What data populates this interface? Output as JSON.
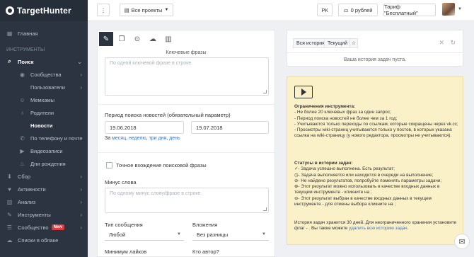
{
  "app": {
    "name": "TargetHunter"
  },
  "sidebar": {
    "main": "Главная",
    "section": "ИНСТРУМЕНТЫ",
    "search": "Поиск",
    "sub": [
      "Сообщества",
      "Пользователи",
      "Мемхамы",
      "Родители",
      "Новости",
      "По телефону и почте",
      "Видеозаписи",
      "Дни рождения"
    ],
    "groups": [
      "Сбор",
      "Активности",
      "Анализ",
      "Инструменты",
      "Сообщество",
      "Списки в облаке"
    ],
    "new_badge": "New"
  },
  "topbar": {
    "menu_icon": "⋮",
    "projects": "Все проекты",
    "region": "РК",
    "balance": "0 рублей",
    "tariff": "Тариф \"Бесплатный\""
  },
  "form": {
    "keywords_label": "Ключевые фразы",
    "keywords_placeholder": "По одной ключевой фразе в строке.",
    "period_label": "Период поиска новостей (обязательный параметр)",
    "date_from": "19.06.2018",
    "date_to": "19.07.2018",
    "quick_prefix": "За",
    "quick_month": "месяц",
    "quick_week": "неделю",
    "quick_3days": "три дня",
    "quick_day": "день",
    "exact_label": "Точное вхождение поисковой фразы",
    "minus_label": "Минус слова",
    "minus_placeholder": "По одному минус слову/фразе в строке",
    "msg_type_label": "Тип сообщения",
    "msg_type_value": "Любой",
    "attach_label": "Вложения",
    "attach_value": "Без разницы",
    "min_likes_label": "Минимум лайков",
    "author_label": "Кто автор?"
  },
  "history": {
    "tab_all": "Вся история",
    "tab_current": "Текущий",
    "empty": "Ваша история задач пуста."
  },
  "info": {
    "limits_title": "Ограничения инструмента:",
    "limits": [
      "- Не более 20 ключевых фраз за один запрос;",
      "- Период поиска новостей не более чем за 1 год;",
      "- Учитываются только переходы по ссылкам, которые сокращены через vk.cc;",
      "- Просмотры wiki-страниц учитываются только у постов, в которых указана ссылка на wiki-страницу (у нового редактора, просмотры не учитываются)."
    ],
    "status_title": "Статусы в истории задач:",
    "statuses": [
      "- Задача успешно выполнена. Есть результат;",
      "- Задача выполняется или находится в очереди на выполнение;",
      "- Не найдено результатов, попробуйте поменять параметры задачи;",
      "- Этот результат можно использовать в качестве входных данных в текущем инструменте - кликните на ;",
      "- Этот результат выбран в качестве входных данных в текущем инструменте - для отмены выбора кликните на ;"
    ],
    "storage": "История задач хранится 30 дней. Для неограниченного хранения установите флаг - . Вы также можете",
    "storage_link": "удалить всю историю задач."
  }
}
